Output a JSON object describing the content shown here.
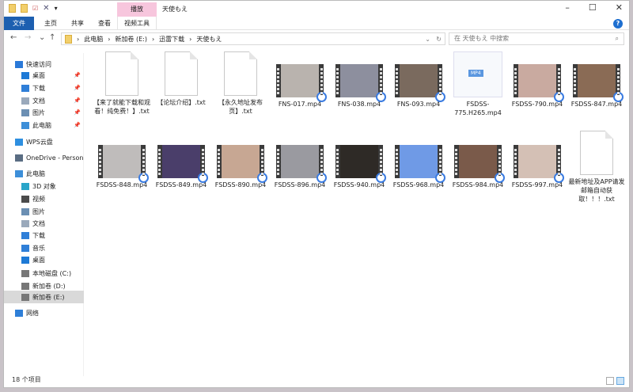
{
  "window": {
    "title": "天使もえ",
    "minimize": "–",
    "maximize": "☐",
    "close": "✕"
  },
  "ribbon": {
    "context_header": "播放",
    "tabs": [
      {
        "label": "文件"
      },
      {
        "label": "主页"
      },
      {
        "label": "共享"
      },
      {
        "label": "查看"
      },
      {
        "label": "视频工具"
      }
    ],
    "help": "?"
  },
  "nav": {
    "back": "←",
    "forward": "→",
    "recent": "⌄",
    "up": "↑",
    "breadcrumb": [
      "此电脑",
      "新加卷 (E:)",
      "迅雷下载",
      "天使もえ"
    ],
    "separator": "›",
    "refresh": "↻",
    "dropdown": "⌄",
    "search_placeholder": "在 天使もえ 中搜索",
    "search_icon": "⌕"
  },
  "sidebar": [
    {
      "label": "快速访问",
      "icon": "star-icon",
      "color": "#2b79d8"
    },
    {
      "label": "桌面",
      "icon": "desktop-icon",
      "color": "#1e7ad6",
      "pinned": true
    },
    {
      "label": "下载",
      "icon": "download-icon",
      "color": "#2f7fd8",
      "pinned": true
    },
    {
      "label": "文档",
      "icon": "document-icon",
      "color": "#9aa9bb",
      "pinned": true
    },
    {
      "label": "图片",
      "icon": "pictures-icon",
      "color": "#6b8fb3",
      "pinned": true
    },
    {
      "label": "此电脑",
      "icon": "computer-icon",
      "color": "#3d8fd9",
      "pinned": true
    },
    {
      "label": "WPS云盘",
      "icon": "cloud-icon",
      "color": "#2e8fe0"
    },
    {
      "label": "OneDrive - Personal",
      "icon": "onedrive-icon",
      "color": "#5a6d83"
    },
    {
      "label": "此电脑",
      "icon": "computer-icon",
      "color": "#3d8fd9"
    },
    {
      "label": "3D 对象",
      "icon": "3d-objects-icon",
      "color": "#2aa5c9"
    },
    {
      "label": "视频",
      "icon": "videos-icon",
      "color": "#4b4b4b"
    },
    {
      "label": "图片",
      "icon": "pictures-icon",
      "color": "#6b8fb3"
    },
    {
      "label": "文档",
      "icon": "document-icon",
      "color": "#9aa9bb"
    },
    {
      "label": "下载",
      "icon": "download-icon",
      "color": "#2f7fd8"
    },
    {
      "label": "音乐",
      "icon": "music-icon",
      "color": "#2f7fd8"
    },
    {
      "label": "桌面",
      "icon": "desktop-icon",
      "color": "#1e7ad6"
    },
    {
      "label": "本地磁盘 (C:)",
      "icon": "drive-c-icon",
      "color": "#777"
    },
    {
      "label": "新加卷 (D:)",
      "icon": "drive-icon",
      "color": "#777"
    },
    {
      "label": "新加卷 (E:)",
      "icon": "drive-icon",
      "color": "#777",
      "selected": true
    },
    {
      "label": "网络",
      "icon": "network-icon",
      "color": "#2f7fd8"
    }
  ],
  "files": [
    {
      "name": "【来了就能下载和观看！纯免费！】.txt",
      "type": "txt"
    },
    {
      "name": "【论坛介绍】.txt",
      "type": "txt"
    },
    {
      "name": "【永久地址发布页】.txt",
      "type": "txt"
    },
    {
      "name": "FNS-017.mp4",
      "type": "video",
      "color": "#b9b3ae"
    },
    {
      "name": "FNS-038.mp4",
      "type": "video",
      "color": "#8d8f9e"
    },
    {
      "name": "FNS-093.mp4",
      "type": "video",
      "color": "#7a6a5e"
    },
    {
      "name": "FSDSS-775.H265.mp4",
      "type": "mp4",
      "badge": "MP4"
    },
    {
      "name": "FSDSS-790.mp4",
      "type": "video",
      "color": "#c9aaa0"
    },
    {
      "name": "FSDSS-847.mp4",
      "type": "video",
      "color": "#8a6b55"
    },
    {
      "name": "FSDSS-848.mp4",
      "type": "video",
      "color": "#bfbcbb"
    },
    {
      "name": "FSDSS-849.mp4",
      "type": "video",
      "color": "#4a3e6a"
    },
    {
      "name": "FSDSS-890.mp4",
      "type": "video",
      "color": "#c7a793"
    },
    {
      "name": "FSDSS-896.mp4",
      "type": "video",
      "color": "#9a9aa0"
    },
    {
      "name": "FSDSS-940.mp4",
      "type": "video",
      "color": "#2e2a26"
    },
    {
      "name": "FSDSS-968.mp4",
      "type": "video",
      "color": "#6f9ae6"
    },
    {
      "name": "FSDSS-984.mp4",
      "type": "video",
      "color": "#7a5a4a"
    },
    {
      "name": "FSDSS-997.mp4",
      "type": "video",
      "color": "#d4c0b5"
    },
    {
      "name": "最新地址及APP请发邮箱自动获取！！！.txt",
      "type": "txt"
    }
  ],
  "status": {
    "count": "18 个项目"
  }
}
